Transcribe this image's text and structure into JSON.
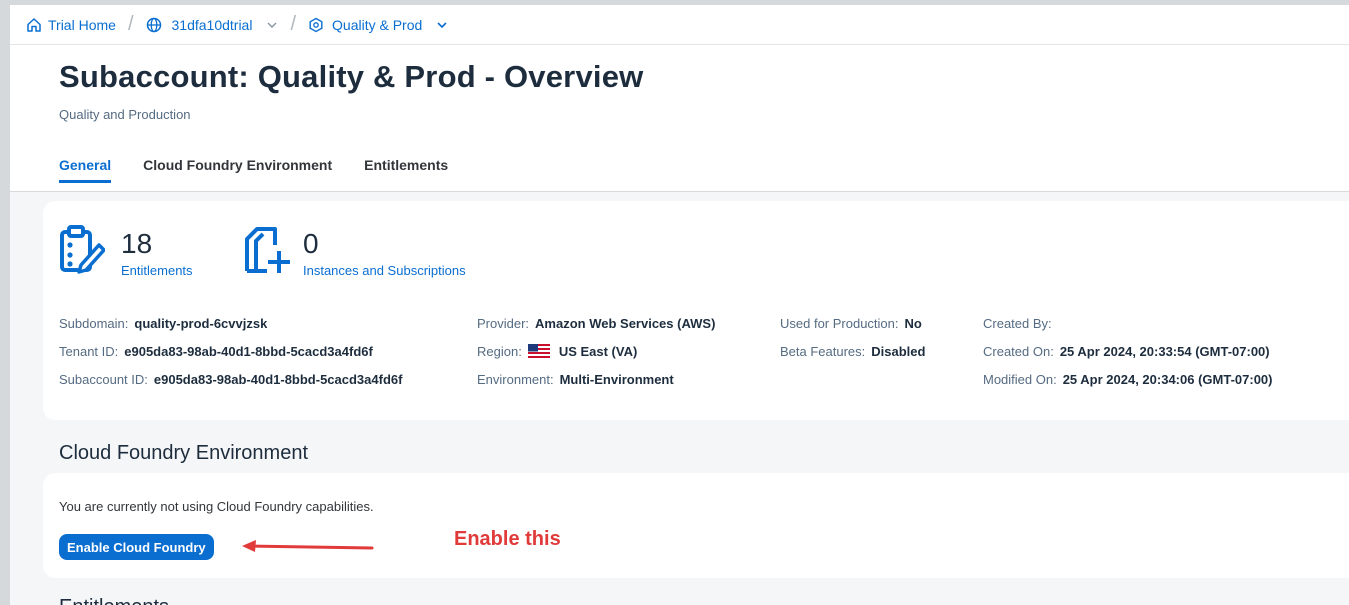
{
  "breadcrumb": {
    "home": "Trial Home",
    "global_account": "31dfa10dtrial",
    "subaccount": "Quality & Prod"
  },
  "header": {
    "title": "Subaccount: Quality & Prod - Overview",
    "subtitle": "Quality and Production"
  },
  "tabs": [
    {
      "label": "General",
      "active": true
    },
    {
      "label": "Cloud Foundry Environment",
      "active": false
    },
    {
      "label": "Entitlements",
      "active": false
    }
  ],
  "stats": [
    {
      "value": "18",
      "label": "Entitlements",
      "icon": "entitlements-icon"
    },
    {
      "value": "0",
      "label": "Instances and Subscriptions",
      "icon": "instances-icon"
    }
  ],
  "details": {
    "col1": [
      {
        "key": "Subdomain:",
        "value": "quality-prod-6cvvjzsk"
      },
      {
        "key": "Tenant ID:",
        "value": "e905da83-98ab-40d1-8bbd-5cacd3a4fd6f"
      },
      {
        "key": "Subaccount ID:",
        "value": "e905da83-98ab-40d1-8bbd-5cacd3a4fd6f"
      }
    ],
    "col2": [
      {
        "key": "Provider:",
        "value": "Amazon Web Services (AWS)"
      },
      {
        "key": "Region:",
        "value": "US East (VA)",
        "icon": "us-flag-icon"
      },
      {
        "key": "Environment:",
        "value": "Multi-Environment"
      }
    ],
    "col3": [
      {
        "key": "Used for Production:",
        "value": "No"
      },
      {
        "key": "Beta Features:",
        "value": "Disabled"
      }
    ],
    "col4": [
      {
        "key": "Created By:",
        "value": ""
      },
      {
        "key": "Created On:",
        "value": "25 Apr 2024, 20:33:54 (GMT-07:00)"
      },
      {
        "key": "Modified On:",
        "value": "25 Apr 2024, 20:34:06 (GMT-07:00)"
      }
    ]
  },
  "cloud_foundry": {
    "section_title": "Cloud Foundry Environment",
    "message": "You are currently not using Cloud Foundry capabilities.",
    "button_label": "Enable Cloud Foundry"
  },
  "annotation": {
    "text": "Enable this",
    "color": "#e13a3a"
  },
  "next_section_title": "Entitlements",
  "colors": {
    "accent": "#0a6ed1",
    "title": "#1d2d3e",
    "label": "#556b82"
  }
}
